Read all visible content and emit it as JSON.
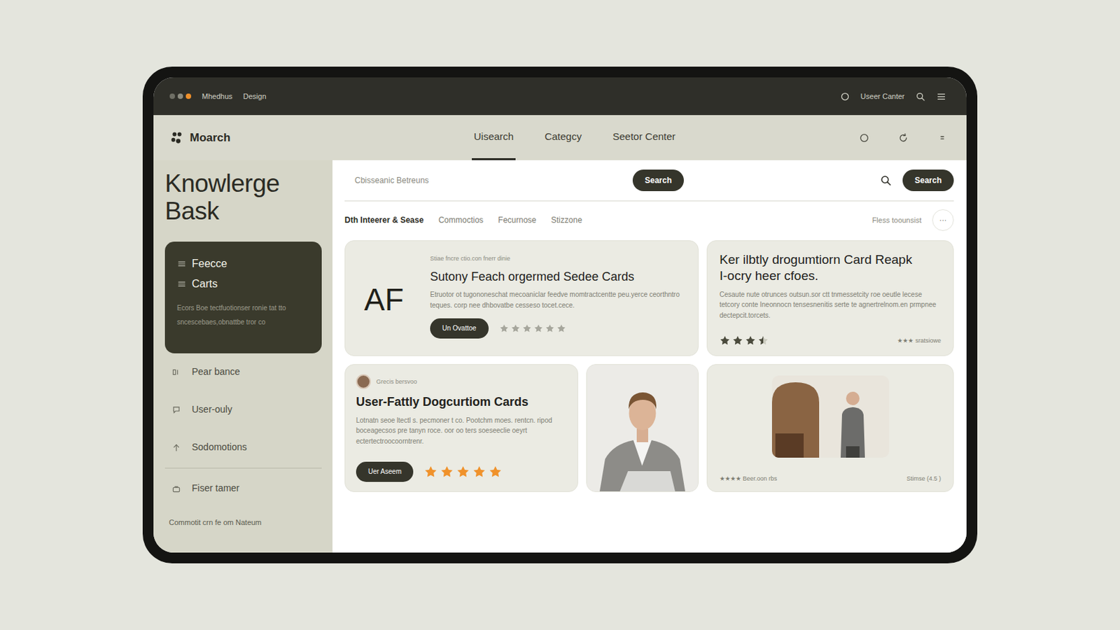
{
  "window": {
    "dots": [
      {
        "color": "#6e6e64"
      },
      {
        "color": "#8c8c80"
      },
      {
        "color": "#f0902a"
      }
    ],
    "menu": [
      "Mhedhus",
      "Design"
    ],
    "user": "Useer Canter"
  },
  "app": {
    "logo": "Moarch",
    "nav": [
      {
        "label": "Uisearch",
        "selected": true
      },
      {
        "label": "Categcy",
        "selected": false
      },
      {
        "label": "Seetor Center",
        "selected": false
      }
    ]
  },
  "sidebar": {
    "title": "Knowlerge Bask",
    "panel": {
      "items": [
        "Feecce",
        "Carts"
      ],
      "text": "Ecors Boe tectfuotionser ronie tat tto sncescebaes,obnattbe tror co"
    },
    "items": [
      {
        "label": "Pear bance"
      },
      {
        "label": "User-ouly"
      },
      {
        "label": "Sodomotions"
      },
      {
        "label": "Fiser tamer"
      }
    ],
    "footer": "Commotit crn fe om Nateum"
  },
  "search": {
    "placeholder": "Cbisseanic Betreuns",
    "button": "Search",
    "button_right": "Search"
  },
  "filters": {
    "items": [
      {
        "label": "Dth Inteerer & Sease",
        "selected": true
      },
      {
        "label": "Commoctios",
        "selected": false
      },
      {
        "label": "Fecurnose",
        "selected": false
      },
      {
        "label": "Stizzone",
        "selected": false
      }
    ],
    "sort": "Fless toounsist",
    "more": "···"
  },
  "cards": [
    {
      "kind": "feature",
      "initials": "AF",
      "caption": "Stiae fncre ctio.con fnerr dinie",
      "title": "Sutony Feach orgermed Sedee Cards",
      "text": "Etruotor ot tugononeschat mecoaniclar feedve momtractcentte peu.yerce ceorthntro teques. corp nee dhbovatbe cesseso tocet.cece.",
      "button": "Un Ovattoe",
      "stars": 0,
      "star_count": 6
    },
    {
      "kind": "doc",
      "title": "Ker ilbtly drogumtiorn Card Reapk I-ocry heer cfoes.",
      "text": "Cesaute nute otrunces outsun.sor ctt tnmessetcity roe oeutle lecese tetcory conte Ineonnocn tensesnenitis serte te agnertrelnom.en prmpnee dectepcit.torcets.",
      "stars": 3.5,
      "star_count": 4,
      "note": "★★★ sratsiowe"
    },
    {
      "kind": "profile",
      "caption": "Grecis bersvoo",
      "title": "User-Fattly Dogcurtiom Cards",
      "text": "Lotnatn seoe ltectl s. pecmoner t co. Pootchm moes. rentcn. ripod boceagecsos pre tanyn roce. oor oo ters soeseeclie oeyrt ectertectroocoorntrenr.",
      "button": "Uer Aseem",
      "stars": 5,
      "star_count": 5
    },
    {
      "kind": "photo"
    },
    {
      "kind": "media",
      "note": "★★★★ Beer.oon rbs",
      "meta": "Stimse (4.5 )"
    }
  ]
}
